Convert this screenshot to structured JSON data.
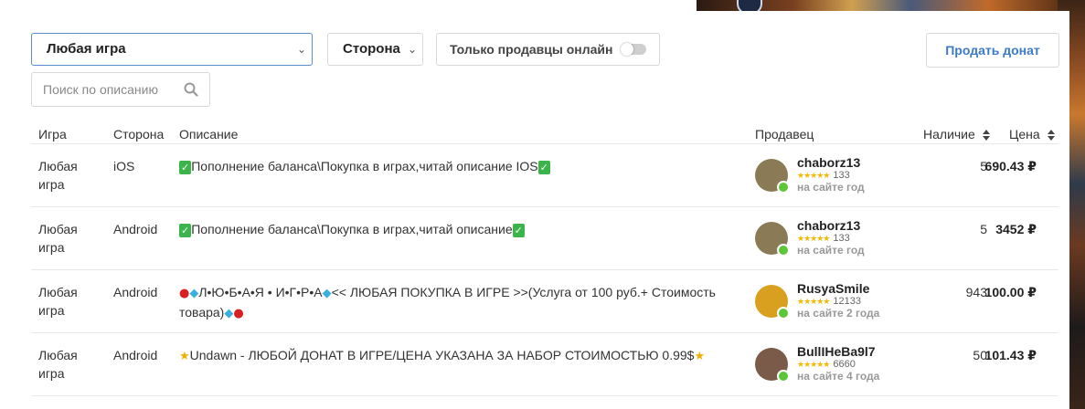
{
  "filters": {
    "game_select": "Любая игра",
    "side_select": "Сторона",
    "online_only_label": "Только продавцы онлайн",
    "online_only_on": false,
    "sell_button": "Продать донат",
    "search_placeholder": "Поиск по описанию"
  },
  "table": {
    "headers": {
      "game": "Игра",
      "side": "Сторона",
      "description": "Описание",
      "seller": "Продавец",
      "stock": "Наличие",
      "price": "Цена"
    },
    "rows": [
      {
        "game": "Любая игра",
        "side": "iOS",
        "description": "Пополнение баланса\\Покупка в играх,читай описание IOS",
        "seller": "chaborz13",
        "rating_count": "133",
        "since": "на сайте год",
        "stock": "5",
        "price": "690.43 ₽",
        "avatar_color": "#8a7a55"
      },
      {
        "game": "Любая игра",
        "side": "Android",
        "description": "Пополнение баланса\\Покупка в играх,читай описание",
        "seller": "chaborz13",
        "rating_count": "133",
        "since": "на сайте год",
        "stock": "5",
        "price": "3452 ₽",
        "avatar_color": "#8a7a55"
      },
      {
        "game": "Любая игра",
        "side": "Android",
        "description_a": "Л•Ю•Б•А•Я • И•Г•Р•А",
        "description_b": "<< ЛЮБАЯ ПОКУПКА В ИГРЕ >>(Услуга от 100 руб.+ Стоимость товара)",
        "seller": "RusyaSmile",
        "rating_count": "12133",
        "since": "на сайте 2 года",
        "stock": "943",
        "price": "100.00 ₽",
        "avatar_color": "#d9a020"
      },
      {
        "game": "Любая игра",
        "side": "Android",
        "description": "Undawn - ЛЮБОЙ ДОНАТ В ИГРЕ/ЦЕНА УКАЗАНА ЗА НАБОР СТОИМОСТЬЮ 0.99$",
        "seller": "BullIHeBa9l7",
        "rating_count": "6660",
        "since": "на сайте 4 года",
        "stock": "50",
        "price": "101.43 ₽",
        "avatar_color": "#7a5a48"
      }
    ]
  },
  "colors": {
    "accent": "#3b7bc8",
    "online": "#5cc638",
    "star": "#f5b800"
  }
}
